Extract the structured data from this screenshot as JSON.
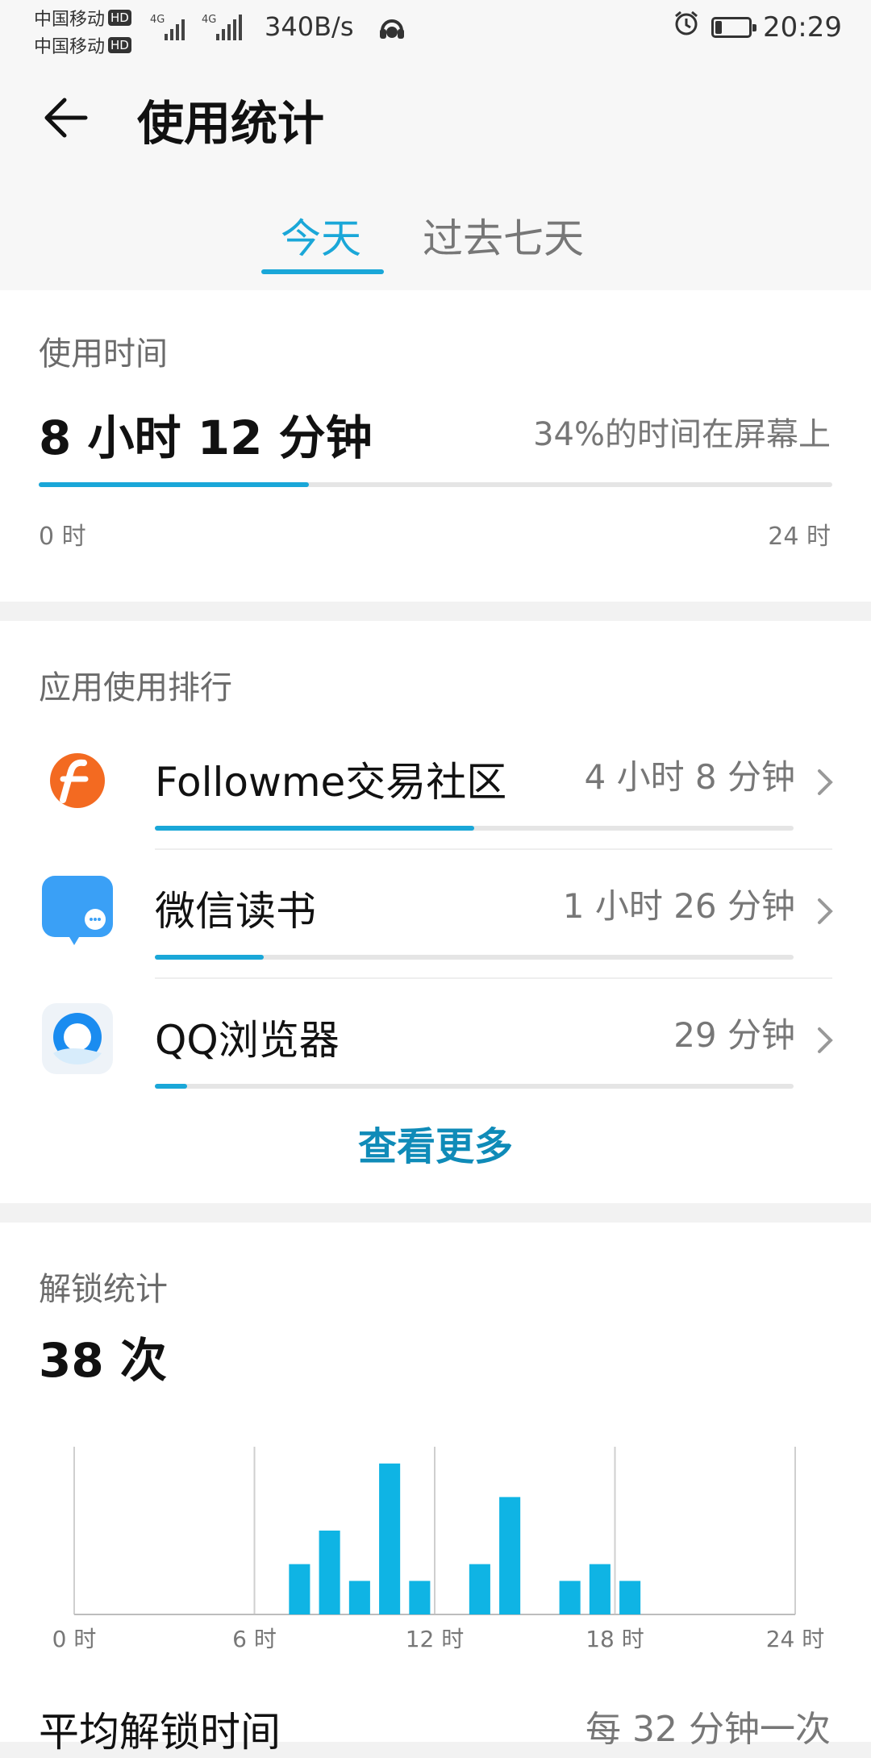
{
  "status_bar": {
    "carrier1": "中国移动",
    "carrier2": "中国移动",
    "hd": "HD",
    "network": "4G",
    "net_speed": "340B/s",
    "time": "20:29",
    "battery_level": 0.2,
    "icons": [
      "signal-icon",
      "headset-icon",
      "alarm-icon",
      "battery-icon"
    ]
  },
  "header": {
    "title": "使用统计",
    "back_icon": "back-arrow-icon"
  },
  "tabs": [
    {
      "label": "今天",
      "active": true
    },
    {
      "label": "过去七天",
      "active": false
    }
  ],
  "usage_time": {
    "label": "使用时间",
    "value": "8 小时 12 分钟",
    "note": "34%的时间在屏幕上",
    "progress": 0.34,
    "scale_start": "0 时",
    "scale_end": "24 时"
  },
  "app_ranking": {
    "label": "应用使用排行",
    "apps": [
      {
        "name": "Followme交易社区",
        "time": "4 小时 8 分钟",
        "progress": 0.5,
        "icon": "followme-icon"
      },
      {
        "name": "微信读书",
        "time": "1 小时 26 分钟",
        "progress": 0.17,
        "icon": "weread-icon"
      },
      {
        "name": "QQ浏览器",
        "time": "29 分钟",
        "progress": 0.05,
        "icon": "qq-browser-icon"
      }
    ],
    "more_label": "查看更多"
  },
  "unlock_stats": {
    "label": "解锁统计",
    "value": "38 次",
    "avg_label": "平均解锁时间",
    "avg_value": "每 32 分钟一次"
  },
  "chart_data": {
    "type": "bar",
    "x": [
      7.5,
      8.5,
      9.5,
      10.5,
      11.5,
      13.5,
      14.5,
      16.5,
      17.5,
      18.5
    ],
    "values": [
      3,
      5,
      2,
      9,
      2,
      3,
      7,
      2,
      3,
      2
    ],
    "xlim": [
      0,
      24
    ],
    "ylim": [
      0,
      10
    ],
    "x_ticks": [
      "0 时",
      "6 时",
      "12 时",
      "18 时",
      "24 时"
    ],
    "color": "#0fb4e4",
    "grid": true
  }
}
